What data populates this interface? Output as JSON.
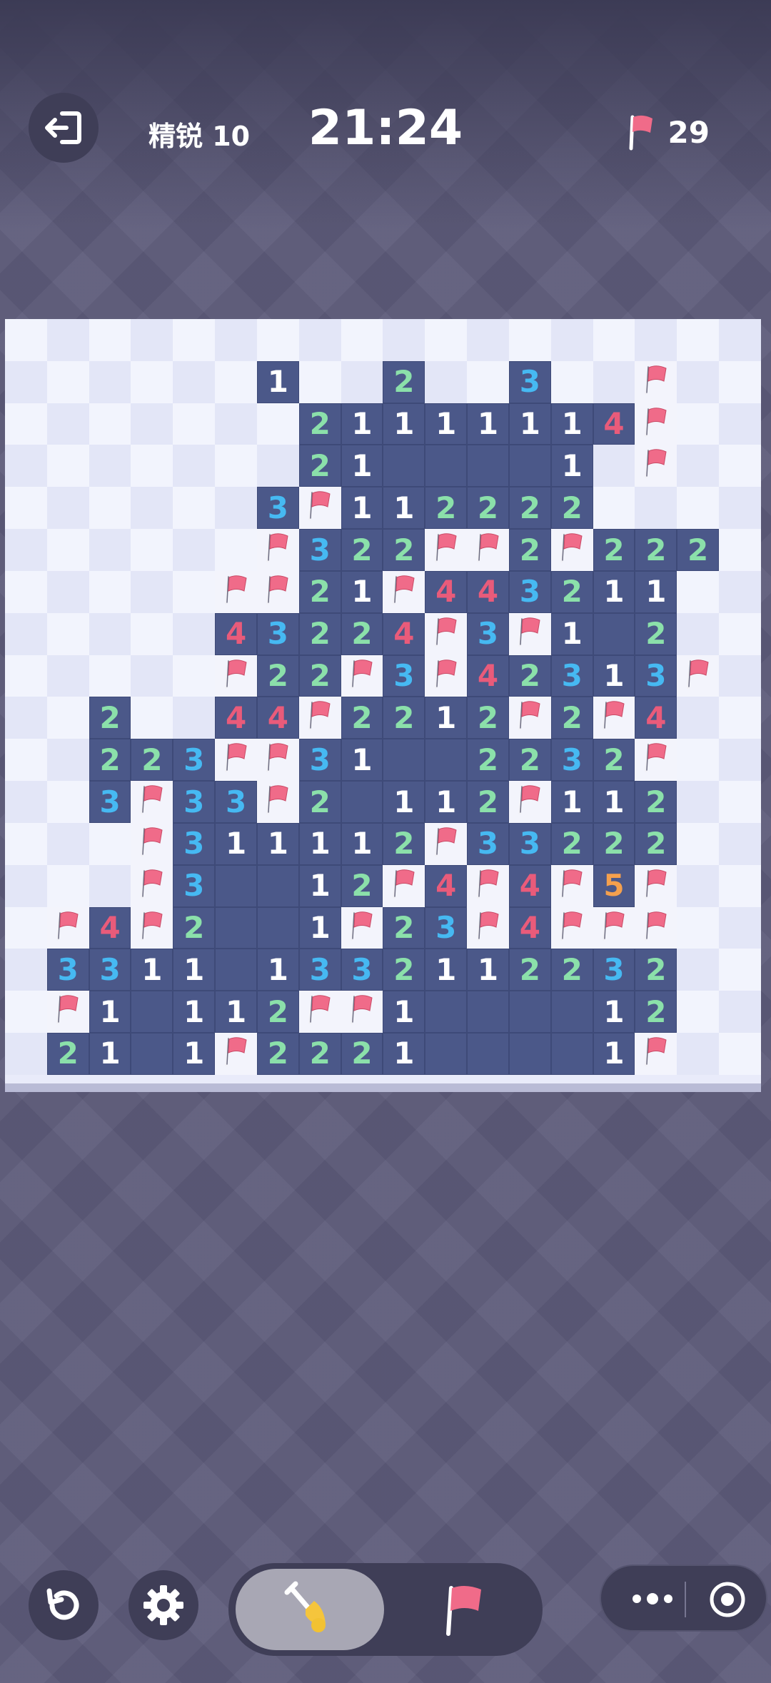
{
  "header": {
    "exit_icon": "exit-icon",
    "level_label": "精锐 10",
    "timer": "21:24",
    "flags_remaining": "29",
    "flag_icon": "flag-icon"
  },
  "colors": {
    "open_cell": "#4b5889",
    "hidden_light": "#f2f4fd",
    "hidden_dark": "#e3e6f7",
    "n1": "#ffffff",
    "n2": "#8be0aa",
    "n3": "#46b9f2",
    "n4": "#e95b7a",
    "n5": "#f5a04d",
    "flag": "#f06b89"
  },
  "board": {
    "columns": 18,
    "rows": 18,
    "legend": "H = hidden, F = flagged, 0 = revealed empty, 1-8 = revealed number",
    "cells": [
      [
        "H",
        "H",
        "H",
        "H",
        "H",
        "H",
        "H",
        "H",
        "H",
        "H",
        "H",
        "H",
        "H",
        "H",
        "H",
        "H",
        "H",
        "H"
      ],
      [
        "H",
        "H",
        "H",
        "H",
        "H",
        "H",
        "1",
        "H",
        "H",
        "2",
        "H",
        "H",
        "3",
        "H",
        "H",
        "F",
        "H",
        "H"
      ],
      [
        "H",
        "H",
        "H",
        "H",
        "H",
        "H",
        "H",
        "2",
        "1",
        "1",
        "1",
        "1",
        "1",
        "1",
        "4",
        "F",
        "H",
        "H"
      ],
      [
        "H",
        "H",
        "H",
        "H",
        "H",
        "H",
        "H",
        "2",
        "1",
        "0",
        "0",
        "0",
        "0",
        "1",
        "H",
        "F",
        "H",
        "H"
      ],
      [
        "H",
        "H",
        "H",
        "H",
        "H",
        "H",
        "3",
        "F",
        "1",
        "1",
        "2",
        "2",
        "2",
        "2",
        "H",
        "H",
        "H",
        "H"
      ],
      [
        "H",
        "H",
        "H",
        "H",
        "H",
        "H",
        "F",
        "3",
        "2",
        "2",
        "F",
        "F",
        "2",
        "F",
        "2",
        "2",
        "2",
        "H"
      ],
      [
        "H",
        "H",
        "H",
        "H",
        "H",
        "F",
        "F",
        "2",
        "1",
        "F",
        "4",
        "4",
        "3",
        "2",
        "1",
        "1",
        "H",
        "H"
      ],
      [
        "H",
        "H",
        "H",
        "H",
        "H",
        "4",
        "3",
        "2",
        "2",
        "4",
        "F",
        "3",
        "F",
        "1",
        "0",
        "2",
        "H",
        "H"
      ],
      [
        "H",
        "H",
        "H",
        "H",
        "H",
        "F",
        "2",
        "2",
        "F",
        "3",
        "F",
        "4",
        "2",
        "3",
        "1",
        "3",
        "F",
        "H"
      ],
      [
        "H",
        "H",
        "2",
        "H",
        "H",
        "4",
        "4",
        "F",
        "2",
        "2",
        "1",
        "2",
        "F",
        "2",
        "F",
        "4",
        "H",
        "H"
      ],
      [
        "H",
        "H",
        "2",
        "2",
        "3",
        "F",
        "F",
        "3",
        "1",
        "0",
        "0",
        "2",
        "2",
        "3",
        "2",
        "F",
        "H",
        "H"
      ],
      [
        "H",
        "H",
        "3",
        "F",
        "3",
        "3",
        "F",
        "2",
        "0",
        "1",
        "1",
        "2",
        "F",
        "1",
        "1",
        "2",
        "H",
        "H"
      ],
      [
        "H",
        "H",
        "H",
        "F",
        "3",
        "1",
        "1",
        "1",
        "1",
        "2",
        "F",
        "3",
        "3",
        "2",
        "2",
        "2",
        "H",
        "H"
      ],
      [
        "H",
        "H",
        "H",
        "F",
        "3",
        "0",
        "0",
        "1",
        "2",
        "F",
        "4",
        "F",
        "4",
        "F",
        "5",
        "F",
        "H",
        "H"
      ],
      [
        "H",
        "F",
        "4",
        "F",
        "2",
        "0",
        "0",
        "1",
        "F",
        "2",
        "3",
        "F",
        "4",
        "F",
        "F",
        "F",
        "H",
        "H"
      ],
      [
        "H",
        "3",
        "3",
        "1",
        "1",
        "0",
        "1",
        "3",
        "3",
        "2",
        "1",
        "1",
        "2",
        "2",
        "3",
        "2",
        "H",
        "H"
      ],
      [
        "H",
        "F",
        "1",
        "0",
        "1",
        "1",
        "2",
        "F",
        "F",
        "1",
        "0",
        "0",
        "0",
        "0",
        "1",
        "2",
        "H",
        "H"
      ],
      [
        "H",
        "2",
        "1",
        "0",
        "1",
        "F",
        "2",
        "2",
        "2",
        "1",
        "0",
        "0",
        "0",
        "0",
        "1",
        "F",
        "H",
        "H"
      ]
    ]
  },
  "controls": {
    "undo_icon": "undo-icon",
    "settings_icon": "gear-icon",
    "dig_mode_icon": "shovel-icon",
    "flag_mode_icon": "flag-icon",
    "more_icon": "more-icon",
    "target_icon": "target-icon",
    "active_mode": "dig"
  }
}
